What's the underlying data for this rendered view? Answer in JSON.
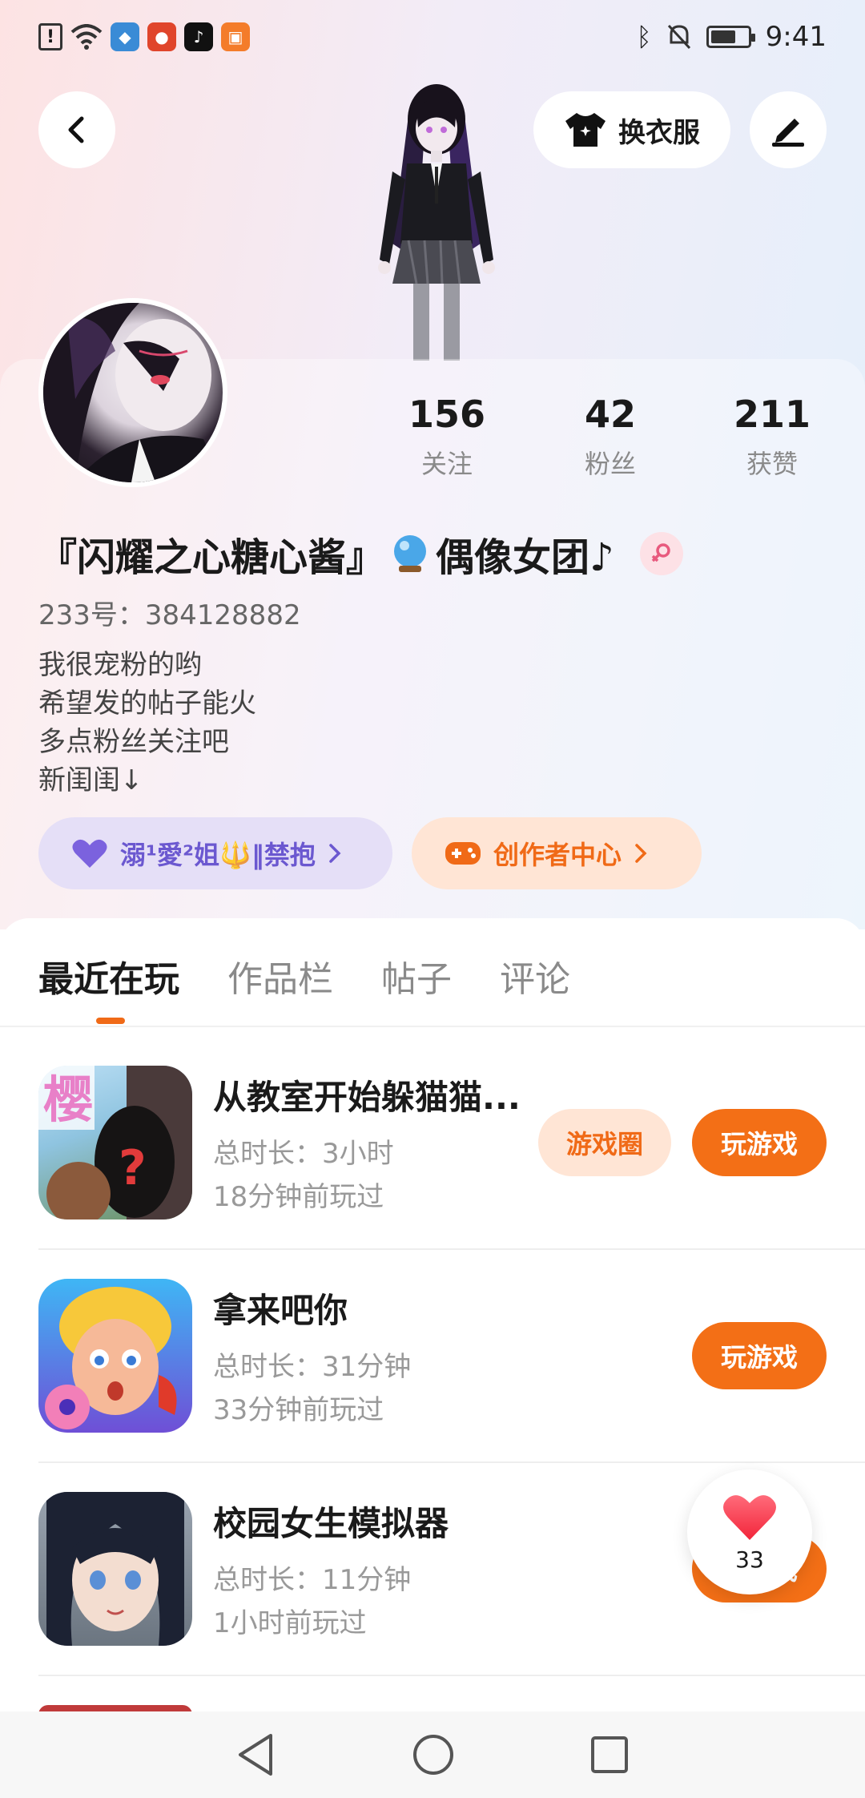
{
  "status_bar": {
    "time": "9:41"
  },
  "header": {
    "outfit_label": "换衣服"
  },
  "profile": {
    "stats": [
      {
        "value": "156",
        "label": "关注"
      },
      {
        "value": "42",
        "label": "粉丝"
      },
      {
        "value": "211",
        "label": "获赞"
      }
    ],
    "nickname_part1": "『闪耀之心糖心酱』",
    "nickname_part2": "偶像女团♪",
    "uid": "233号：384128882",
    "bio_lines": [
      "我很宠粉的哟",
      "希望发的帖子能火",
      "多点粉丝关注吧",
      "新闺闺↓"
    ],
    "friend_pill": "溺¹愛²姐🔱‖禁抱",
    "creator_pill": "创作者中心"
  },
  "tabs": [
    "最近在玩",
    "作品栏",
    "帖子",
    "评论"
  ],
  "games": [
    {
      "title": "从教室开始躲猫猫...",
      "duration": "总时长：3小时",
      "last_played": "18分钟前玩过",
      "circle_label": "游戏圈",
      "play_label": "玩游戏"
    },
    {
      "title": "拿来吧你",
      "duration": "总时长：31分钟",
      "last_played": "33分钟前玩过",
      "play_label": "玩游戏"
    },
    {
      "title": "校园女生模拟器",
      "duration": "总时长：11分钟",
      "last_played": "1小时前玩过",
      "play_label": "玩游戏"
    }
  ],
  "like_fab": {
    "count": "33"
  },
  "colors": {
    "accent": "#f36f16",
    "purple": "#6b58d0"
  }
}
